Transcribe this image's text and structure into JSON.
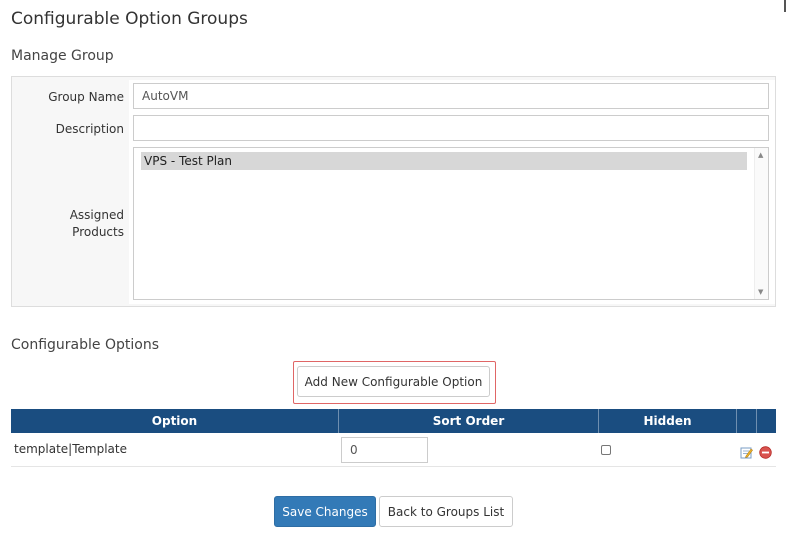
{
  "page": {
    "title": "Configurable Option Groups"
  },
  "manage_group": {
    "heading": "Manage Group",
    "group_name_label": "Group Name",
    "group_name_value": "AutoVM",
    "description_label": "Description",
    "description_value": "",
    "assigned_products_label_line1": "Assigned",
    "assigned_products_label_line2": "Products",
    "assigned_products": [
      "VPS - Test Plan"
    ]
  },
  "configurable_options": {
    "heading": "Configurable Options",
    "add_button_label": "Add New Configurable Option",
    "columns": [
      "Option",
      "Sort Order",
      "Hidden"
    ],
    "rows": [
      {
        "option": "template|Template",
        "sort_order": "0",
        "hidden": false
      }
    ],
    "row_icons": [
      "edit-icon",
      "delete-icon"
    ]
  },
  "footer": {
    "save_label": "Save Changes",
    "back_label": "Back to Groups List"
  },
  "colors": {
    "table_header": "#1a4d80",
    "primary_button": "#337ab7",
    "highlight_outline": "#e06666",
    "delete_icon": "#d9534f"
  }
}
